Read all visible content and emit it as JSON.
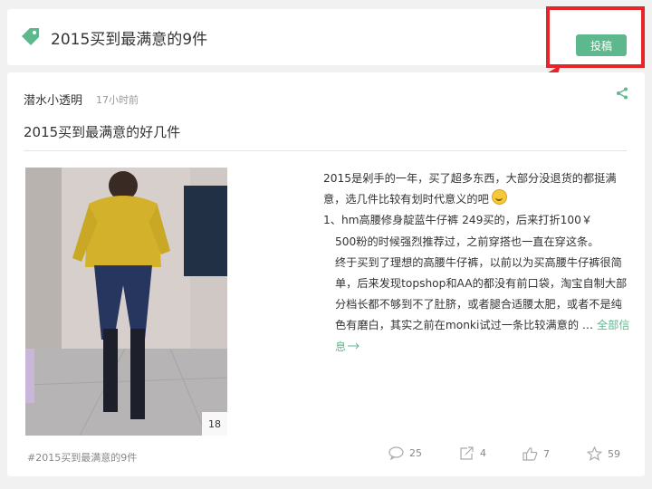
{
  "header": {
    "title": "2015买到最满意的9件",
    "submit_label": "投稿"
  },
  "post": {
    "author": "潜水小透明",
    "time": "17小时前",
    "title": "2015买到最满意的好几件",
    "photo_count": "18",
    "paragraphs": [
      "2015是剁手的一年，买了超多东西，大部分没退货的都挺满意，选几件比较有划时代意义的吧",
      "1、hm高腰修身靛蓝牛仔裤 249买的，后来打折100￥",
      "500粉的时候强烈推荐过，之前穿搭也一直在穿这条。",
      "终于买到了理想的高腰牛仔裤，以前以为买高腰牛仔裤很简单，后来发现topshop和AA的都没有前口袋，淘宝自制大部分档长都不够到不了肚脐，或者腿合适腰太肥，或者不是纯色有磨白，其实之前在monki试过一条比较满意的 … "
    ],
    "more_label": "全部信息",
    "tag": "#2015买到最满意的9件",
    "stats": {
      "comments": "25",
      "shares": "4",
      "likes": "7",
      "favorites": "59"
    }
  },
  "colors": {
    "accent": "#5eb88e",
    "highlight_box": "#e5252a"
  },
  "icons": [
    "tag-icon",
    "share-icon",
    "comment-icon",
    "forward-icon",
    "thumbs-up-icon",
    "star-icon"
  ]
}
